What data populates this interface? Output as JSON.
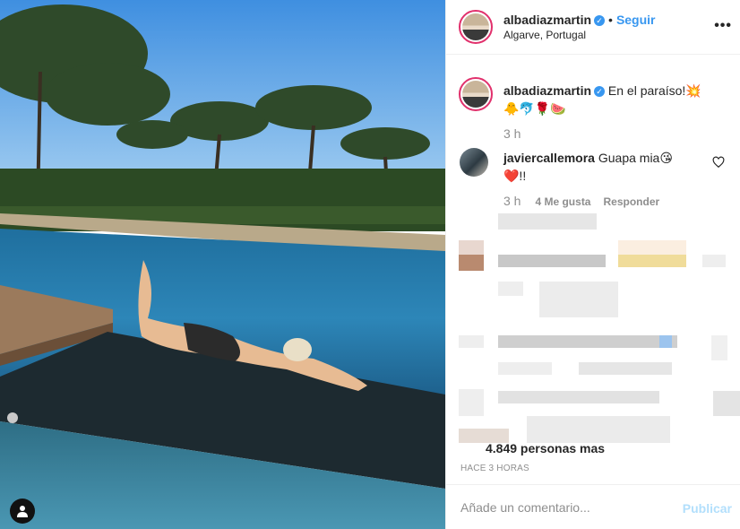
{
  "post": {
    "username": "albadiazmartin",
    "verified": "✓",
    "separator": "•",
    "follow_label": "Seguir",
    "location": "Algarve, Portugal",
    "more_label": "•••"
  },
  "caption": {
    "username": "albadiazmartin",
    "text": "En el paraíso!💥",
    "emojis": "🐥🐬🌹🍉",
    "time": "3 h"
  },
  "comment": {
    "username": "javiercallemora",
    "text": "Guapa mia😘",
    "text2": "❤️!!",
    "time": "3 h",
    "likes": "4 Me gusta",
    "reply": "Responder"
  },
  "likes_text": "4.849 personas mas",
  "timestamp": "HACE 3 HORAS",
  "footer": {
    "placeholder": "Añade un comentario...",
    "publish_label": "Publicar"
  },
  "colors": {
    "accent": "#3897f0",
    "publish_disabled": "#b2dffc",
    "muted": "#8e8e8e"
  }
}
